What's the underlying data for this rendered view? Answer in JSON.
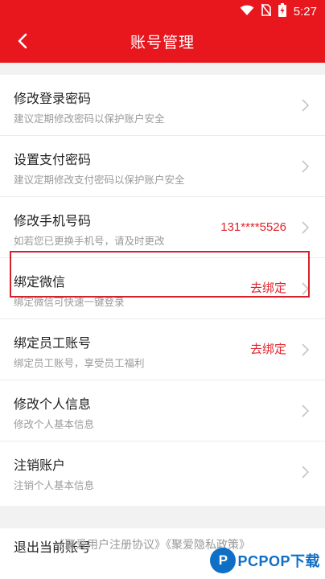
{
  "status_bar": {
    "time": "5:27",
    "icons": [
      "wifi-icon",
      "no-sim-icon",
      "battery-charging-icon"
    ]
  },
  "header": {
    "title": "账号管理",
    "back_icon": "chevron-left-icon"
  },
  "colors": {
    "brand": "#e8161d",
    "action_text": "#e2232b",
    "highlight_border": "#d8202b",
    "watermark": "#0f6fc6"
  },
  "settings": {
    "items": [
      {
        "title": "修改登录密码",
        "subtitle": "建议定期修改密码以保护账户安全",
        "value": ""
      },
      {
        "title": "设置支付密码",
        "subtitle": "建议定期修改支付密码以保护账户安全",
        "value": ""
      },
      {
        "title": "修改手机号码",
        "subtitle": "如若您已更换手机号，请及时更改",
        "value": "131****5526"
      },
      {
        "title": "绑定微信",
        "subtitle": "绑定微信可快速一键登录",
        "value": "去绑定"
      },
      {
        "title": "绑定员工账号",
        "subtitle": "绑定员工账号，享受员工福利",
        "value": "去绑定"
      },
      {
        "title": "修改个人信息",
        "subtitle": "修改个人基本信息",
        "value": ""
      },
      {
        "title": "注销账户",
        "subtitle": "注销个人基本信息",
        "value": ""
      }
    ]
  },
  "footer": {
    "logout_label": "退出当前账号",
    "agreements_text": "《聚爱用户注册协议》《聚爱隐私政策》"
  },
  "watermark": {
    "logo_letter": "P",
    "text": "PCPOP下载"
  }
}
